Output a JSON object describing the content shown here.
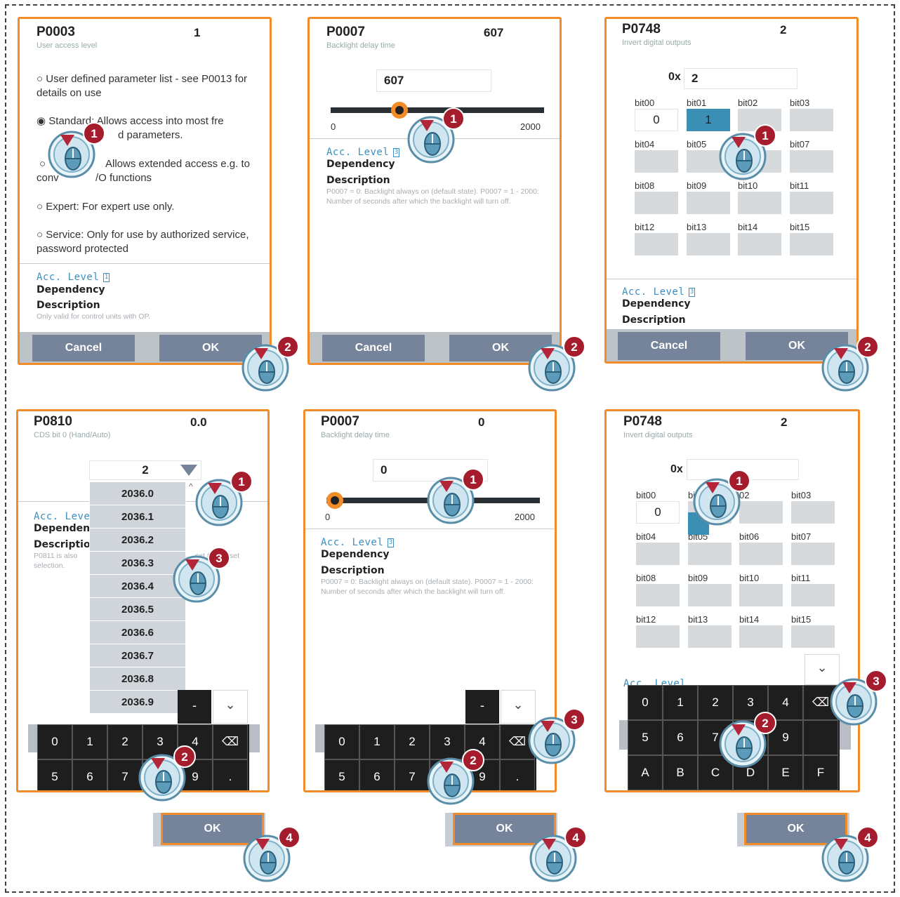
{
  "panels": {
    "p1": {
      "param": "P0003",
      "value": "1",
      "subtitle": "User access level",
      "options": [
        "User defined parameter list - see P0013 for details on use",
        "Standard: Allows access into most fre",
        "d parameters.",
        "Allows extended access e.g. to",
        "conv",
        "/O functions",
        "Expert: For expert use only.",
        "Service: Only for use by authorized service, password protected"
      ],
      "acc_label": "Acc. Level",
      "acc_value": "1",
      "dependency": "Dependency",
      "description_label": "Description",
      "description": "Only valid for control units with OP.",
      "cancel": "Cancel",
      "ok": "OK"
    },
    "p2": {
      "param": "P0007",
      "value": "607",
      "subtitle": "Backlight delay time",
      "input": "607",
      "min": "0",
      "max": "2000",
      "slider_value": 607,
      "acc_label": "Acc. Level",
      "acc_value": "3",
      "dependency": "Dependency",
      "description_label": "Description",
      "description": "P0007 = 0: Backlight always on (default state). P0007 = 1 - 2000: Number of seconds after which the backlight will turn off.",
      "cancel": "Cancel",
      "ok": "OK"
    },
    "p3": {
      "param": "P0748",
      "value": "2",
      "subtitle": "Invert digital outputs",
      "prefix": "0x",
      "input": "2",
      "bits": [
        "bit00",
        "bit01",
        "bit02",
        "bit03",
        "bit04",
        "bit05",
        "bit06",
        "bit07",
        "bit08",
        "bit09",
        "bit10",
        "bit11",
        "bit12",
        "bit13",
        "bit14",
        "bit15"
      ],
      "bit00_value": "0",
      "bit01_value": "1",
      "acc_label": "Acc. Level",
      "acc_value": "3",
      "dependency": "Dependency",
      "description_label": "Description",
      "cancel": "Cancel",
      "ok": "OK"
    },
    "p4": {
      "param": "P0810",
      "value": "0.0",
      "subtitle": "CDS bit 0 (Hand/Auto)",
      "dropdown": "2",
      "list": [
        "2036.0",
        "2036.1",
        "2036.2",
        "2036.3",
        "2036.4",
        "2036.5",
        "2036.6",
        "2036.7",
        "2036.8",
        "2036.9"
      ],
      "acc_label": "Acc. Level",
      "dependency": "Dependenc",
      "description_label": "Description",
      "desc1": "P0811 is also",
      "desc2": "selection.",
      "desc_right": "set (CDS) set",
      "keys_row1": [
        "0",
        "1",
        "2",
        "3",
        "4",
        "⌫"
      ],
      "keys_row2": [
        "5",
        "6",
        "7",
        "",
        "9",
        "."
      ],
      "minus": "-",
      "chevron": "⌄",
      "ok": "OK"
    },
    "p5": {
      "param": "P0007",
      "value": "0",
      "subtitle": "Backlight delay time",
      "input": "0",
      "min": "0",
      "max": "2000",
      "slider_value": 0,
      "acc_label": "Acc. Level",
      "acc_value": "3",
      "dependency": "Dependency",
      "description_label": "Description",
      "description": "P0007 = 0: Backlight always on (default state). P0007 = 1 - 2000: Number of seconds after which the backlight will turn off.",
      "keys_row1": [
        "0",
        "1",
        "2",
        "3",
        "4",
        "⌫"
      ],
      "keys_row2": [
        "5",
        "6",
        "7",
        "",
        "9",
        "."
      ],
      "minus": "-",
      "chevron": "⌄",
      "ok": "OK"
    },
    "p6": {
      "param": "P0748",
      "value": "2",
      "subtitle": "Invert digital outputs",
      "prefix": "0x",
      "bits": [
        "bit00",
        "bi",
        "02",
        "bit03",
        "bit04",
        "bit05",
        "bit06",
        "bit07",
        "bit08",
        "bit09",
        "bit10",
        "bit11",
        "bit12",
        "bit13",
        "bit14",
        "bit15"
      ],
      "bit00_value": "0",
      "acc_partial": "Acc. Level",
      "keys_row1": [
        "0",
        "1",
        "2",
        "3",
        "4",
        "⌫"
      ],
      "keys_row2": [
        "5",
        "6",
        "7",
        "8",
        "9",
        ""
      ],
      "keys_row3": [
        "A",
        "B",
        "C",
        "D",
        "E",
        "F"
      ],
      "chevron": "⌄",
      "ok": "OK"
    }
  },
  "steps": [
    "1",
    "2",
    "3",
    "4"
  ],
  "colors": {
    "accent": "#f28c28",
    "button": "#75849a",
    "selected_bit": "#3b8fb5",
    "link": "#3b8fc0"
  }
}
